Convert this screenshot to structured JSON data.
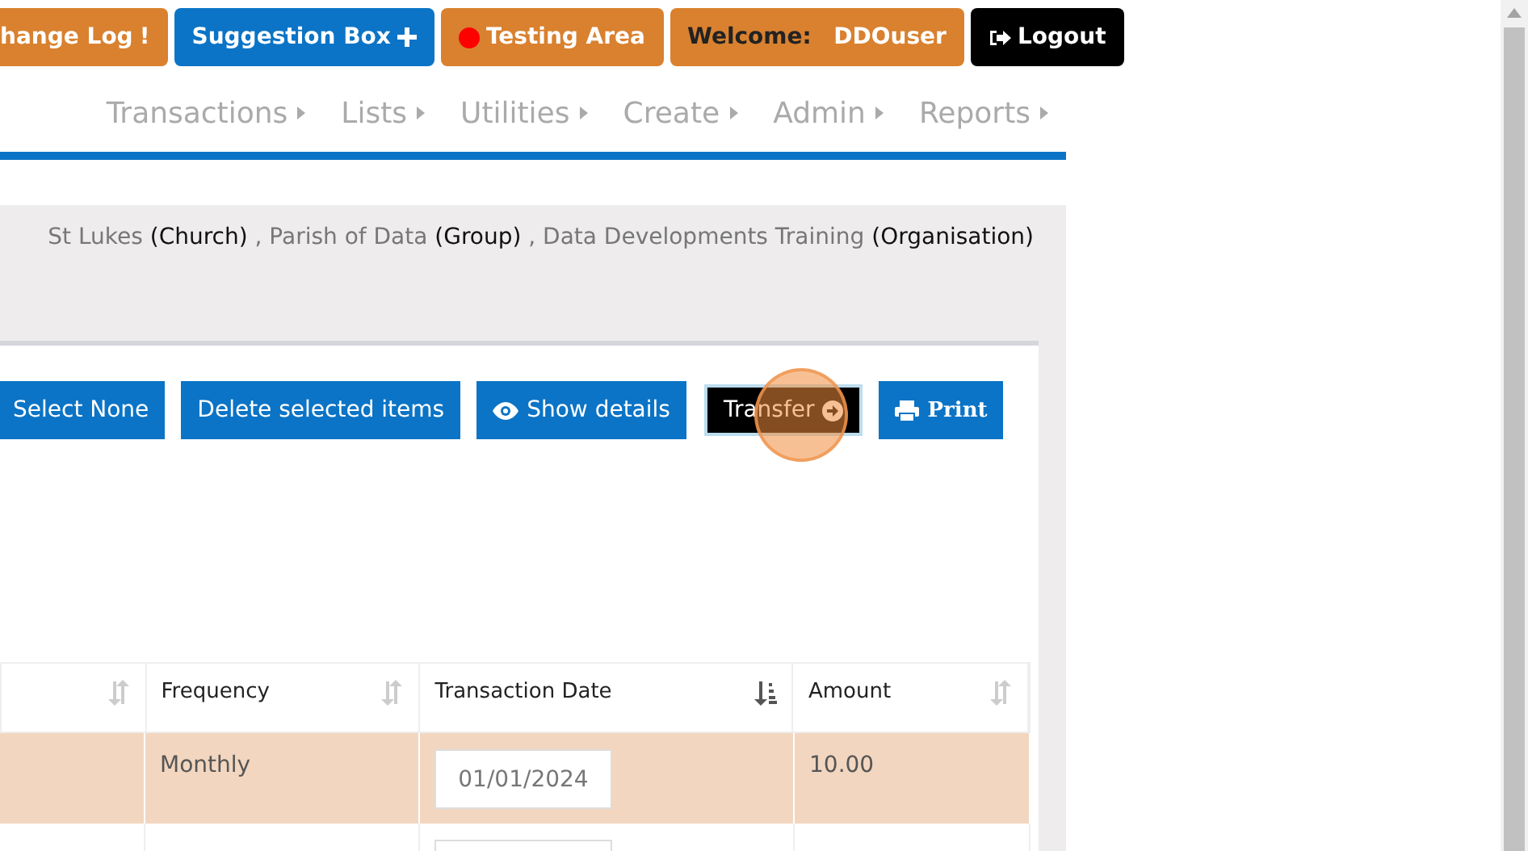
{
  "top_buttons": [
    {
      "label": "hange Log",
      "icon_text": "!",
      "kind": "changelog"
    },
    {
      "label": "Suggestion Box",
      "kind": "suggest"
    },
    {
      "label": "Testing Area",
      "kind": "testing"
    },
    {
      "label": "Welcome:",
      "user": "DDOuser",
      "kind": "welcome"
    },
    {
      "label": "Logout",
      "kind": "logout"
    }
  ],
  "nav": [
    "Transactions",
    "Lists",
    "Utilities",
    "Create",
    "Admin",
    "Reports"
  ],
  "breadcrumb": [
    {
      "name": "St Lukes",
      "type": "(Church)"
    },
    {
      "separator": ",",
      "name": "Parish of Data",
      "type": "(Group)"
    },
    {
      "separator": ",",
      "name": "Data Developments Training",
      "type": "(Organisation)"
    }
  ],
  "actions": [
    {
      "label": "Select None",
      "kind": "plain"
    },
    {
      "label": "Delete selected items",
      "kind": "plain"
    },
    {
      "label": "Show details",
      "kind": "eye"
    },
    {
      "label": "Transfer",
      "kind": "transfer"
    },
    {
      "label": "Print",
      "kind": "print"
    }
  ],
  "table": {
    "columns": [
      {
        "sorted": false
      },
      {
        "label": "Frequency",
        "sorted": false
      },
      {
        "label": "Transaction Date",
        "sorted": true
      },
      {
        "label": "Amount",
        "sorted": false
      }
    ],
    "rows": [
      {
        "selected": true,
        "frequency": "Monthly",
        "date": "01/01/2024",
        "amount": "10.00"
      },
      {
        "selected": false
      }
    ]
  }
}
